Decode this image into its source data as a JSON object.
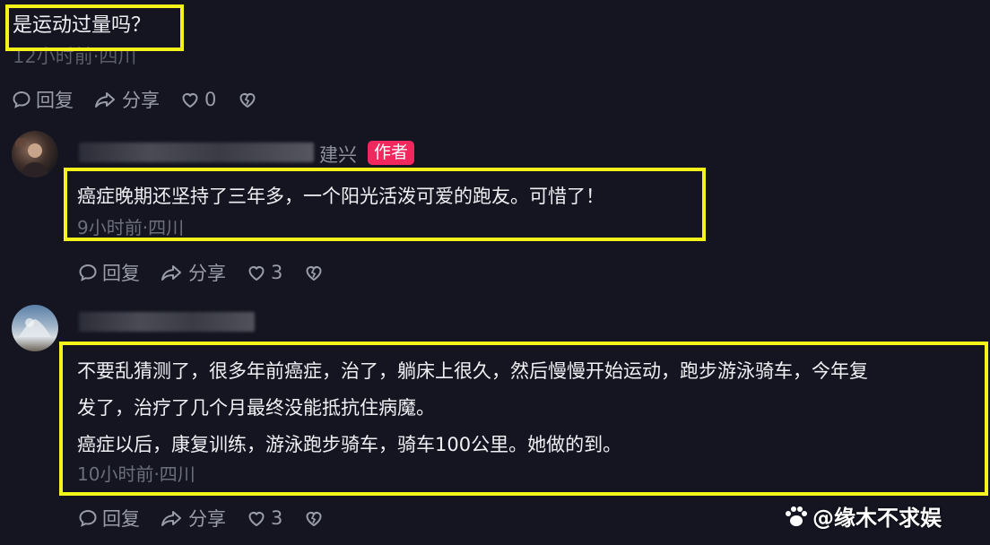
{
  "top_comment": {
    "text": "是运动过量吗？",
    "meta": "12小时前·四川",
    "reply_label": "回复",
    "share_label": "分享",
    "like_count": "0"
  },
  "reply1": {
    "username_suffix": "建兴",
    "author_badge": "作者",
    "text": "癌症晚期还坚持了三年多，一个阳光活泼可爱的跑友。可惜了！",
    "meta": "9小时前·四川",
    "reply_label": "回复",
    "share_label": "分享",
    "like_count": "3"
  },
  "reply2": {
    "line1": "不要乱猜测了，很多年前癌症，治了，躺床上很久，然后慢慢开始运动，跑步游泳骑车，今年复",
    "line2": "发了，治疗了几个月最终没能抵抗住病魔。",
    "line3": "癌症以后，康复训练，游泳跑步骑车，骑车100公里。她做的到。",
    "meta": "10小时前·四川",
    "reply_label": "回复",
    "share_label": "分享",
    "like_count": "3"
  },
  "watermark": "@缘木不求娱",
  "colors": {
    "background": "#141521",
    "highlight": "#f5f31a",
    "author_badge": "#f0285e",
    "meta_text": "#6c6e7c"
  }
}
